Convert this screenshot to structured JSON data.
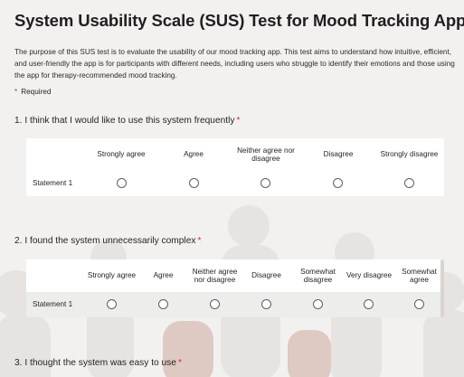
{
  "form": {
    "title": "System Usability Scale (SUS) Test for Mood Tracking App",
    "description": "The purpose of this SUS test is to evaluate the usability of our mood tracking app. This test aims to understand how intuitive, efficient, and user-friendly the app is for participants with different needs, including users who struggle to identify their emotions and those using the app for therapy-recommended mood tracking.",
    "required_star": "*",
    "required_label": "Required"
  },
  "questions": [
    {
      "text": "1. I think that I would like to use this system frequently",
      "star": "*",
      "columns": [
        "Strongly agree",
        "Agree",
        "Neither agree nor disagree",
        "Disagree",
        "Strongly disagree"
      ],
      "statement": "Statement 1"
    },
    {
      "text": "2. I found the system unnecessarily complex",
      "star": "*",
      "columns": [
        "Strongly agree",
        "Agree",
        "Neither agree nor disagree",
        "Disagree",
        "Somewhat disagree",
        "Very disagree",
        "Somewhat agree"
      ],
      "statement": "Statement 1"
    },
    {
      "text": "3. I thought the system was easy to use",
      "star": "*"
    }
  ],
  "colors": {
    "background": "#f2f1ef",
    "required": "#c4314b",
    "grid_bg": "#ffffff",
    "alt_row": "#ededeb"
  }
}
